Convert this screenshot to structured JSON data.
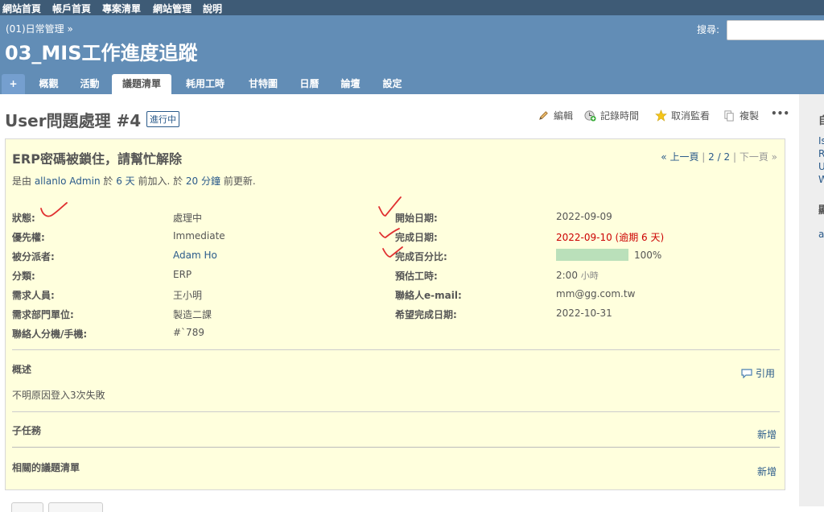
{
  "top_menu": [
    "網站首頁",
    "帳戶首頁",
    "專案清單",
    "網站管理",
    "說明"
  ],
  "header": {
    "breadcrumb": "(01)日常管理 »",
    "project_title": "03_MIS工作進度追蹤",
    "search_label": "搜尋:"
  },
  "tabs": [
    "+",
    "概觀",
    "活動",
    "議題清單",
    "耗用工時",
    "甘特圖",
    "日曆",
    "論壇",
    "設定"
  ],
  "selected_tab": "議題清單",
  "issue": {
    "title": "User問題處理 #4",
    "status_badge": "進行中",
    "actions": {
      "edit": "編輯",
      "log_time": "記錄時間",
      "unwatch": "取消監看",
      "copy": "複製",
      "more": "•••"
    },
    "subject": "ERP密碼被鎖住，請幫忙解除",
    "pager": {
      "prev": "« 上一頁",
      "sep1": "|",
      "position": "2 / 2",
      "sep2": "|",
      "next": "下一頁 »"
    },
    "author_line": {
      "prefix": "是由 ",
      "author": "allanlo Admin",
      "mid1": " 於 ",
      "created_ago": "6 天",
      "mid2": " 前加入. 於 ",
      "updated_ago": "20 分鐘",
      "suffix": " 前更新."
    },
    "attributes_left": [
      {
        "label": "狀態:",
        "value": "處理中"
      },
      {
        "label": "優先權:",
        "value": "Immediate"
      },
      {
        "label": "被分派者:",
        "value": "Adam Ho"
      },
      {
        "label": "分類:",
        "value": "ERP"
      },
      {
        "label": "需求人員:",
        "value": "王小明"
      },
      {
        "label": "需求部門單位:",
        "value": "製造二課"
      },
      {
        "label": "聯絡人分機/手機:",
        "value": "#`789"
      }
    ],
    "attributes_right": [
      {
        "label": "開始日期:",
        "value": "2022-09-09"
      },
      {
        "label": "完成日期:",
        "value": "2022-09-10 (逾期 6 天)"
      },
      {
        "label": "完成百分比:",
        "value": "100%",
        "percent": 100
      },
      {
        "label": "預估工時:",
        "value": "2:00",
        "unit": "小時"
      },
      {
        "label": "聯絡人e-mail:",
        "value": "mm@gg.com.tw"
      },
      {
        "label": "希望完成日期:",
        "value": "2022-10-31"
      }
    ],
    "description": {
      "title": "概述",
      "quote": "引用",
      "text": "不明原因登入3次失敗"
    },
    "subtasks": {
      "title": "子任務",
      "add": "新增"
    },
    "relations": {
      "title": "相關的議題清單",
      "add": "新增"
    }
  },
  "sidebar": {
    "heading1": "自",
    "links": [
      "Is",
      "R",
      "U",
      "W"
    ],
    "heading2": "顯",
    "link2": "a"
  },
  "colors": {
    "top_menu": "#3e5b76",
    "header": "#628db6",
    "issue_bg": "#ffffdd",
    "progress": "#bae0ba",
    "overdue": "#cc0000",
    "check_marks": "#e03030"
  }
}
